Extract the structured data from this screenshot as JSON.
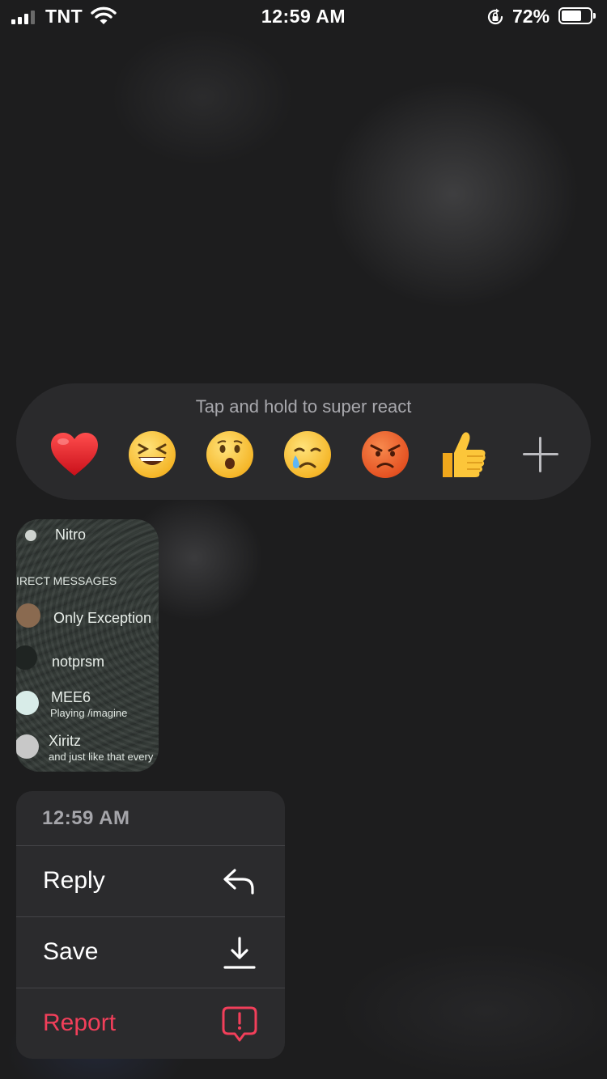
{
  "status_bar": {
    "carrier": "TNT",
    "time": "12:59 AM",
    "battery_percent": "72%",
    "battery_level": 0.72,
    "signal_bars": 3,
    "icons": [
      "signal-icon",
      "wifi-icon",
      "rotation-lock-icon",
      "battery-icon"
    ]
  },
  "reaction_bar": {
    "hint": "Tap and hold to super react",
    "reactions": [
      {
        "name": "heart",
        "glyph": "❤️"
      },
      {
        "name": "laughing",
        "glyph": "😆"
      },
      {
        "name": "surprised",
        "glyph": "😮"
      },
      {
        "name": "crying",
        "glyph": "😢"
      },
      {
        "name": "angry",
        "glyph": "😡"
      },
      {
        "name": "thumbs-up",
        "glyph": "👍"
      }
    ],
    "more_icon": "plus-icon"
  },
  "image_message": {
    "top_item": "Nitro",
    "section_header": "IRECT MESSAGES",
    "dms": [
      {
        "name": "Only Exception",
        "status": ""
      },
      {
        "name": "notprsm",
        "status": ""
      },
      {
        "name": "MEE6",
        "status": "Playing /imagine"
      },
      {
        "name": "Xiritz",
        "status": "and just like that every"
      }
    ]
  },
  "context_menu": {
    "timestamp": "12:59 AM",
    "items": [
      {
        "label": "Reply",
        "icon": "reply-icon",
        "color": "#ffffff"
      },
      {
        "label": "Save",
        "icon": "download-icon",
        "color": "#ffffff"
      },
      {
        "label": "Report",
        "icon": "report-icon",
        "color": "#f23f5a"
      }
    ]
  }
}
